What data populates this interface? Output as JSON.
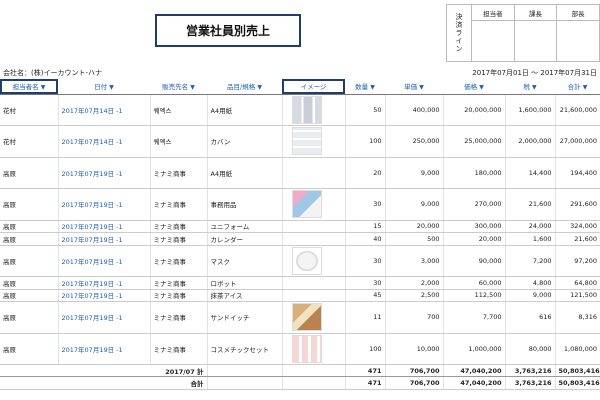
{
  "title": "営業社員別売上",
  "approval": {
    "label": "決済ライン",
    "columns": [
      "担当者",
      "課長",
      "部長"
    ]
  },
  "company": "会社名：(株)イーカウント-ハナ",
  "period": "2017年07月01日 ～ 2017年07月31日",
  "headers": {
    "person": "担当者名",
    "date": "日付",
    "customer": "販売先名",
    "item": "品目/規格",
    "image": "イメージ",
    "qty": "数量",
    "unit_price": "単価",
    "price": "価格",
    "tax": "税",
    "total": "合計",
    "caret": "▼"
  },
  "rows": [
    {
      "person": "花村",
      "date": "2017年07月14日 -1",
      "customer": "퀘엑스",
      "item": "A4用紙",
      "image": "shelf",
      "qty": "50",
      "unit_price": "400,000",
      "price": "20,000,000",
      "tax": "1,600,000",
      "total": "21,600,000"
    },
    {
      "person": "花村",
      "date": "2017年07月14日 -1",
      "customer": "퀘엑스",
      "item": "カバン",
      "image": "bag",
      "qty": "100",
      "unit_price": "250,000",
      "price": "25,000,000",
      "tax": "2,000,000",
      "total": "27,000,000"
    },
    {
      "person": "高原",
      "date": "2017年07月19日 -1",
      "customer": "ミナミ商事",
      "item": "A4用紙",
      "image": "",
      "qty": "20",
      "unit_price": "9,000",
      "price": "180,000",
      "tax": "14,400",
      "total": "194,400"
    },
    {
      "person": "高原",
      "date": "2017年07月19日 -1",
      "customer": "ミナミ商事",
      "item": "事務用品",
      "image": "office",
      "qty": "30",
      "unit_price": "9,000",
      "price": "270,000",
      "tax": "21,600",
      "total": "291,600"
    },
    {
      "person": "高原",
      "date": "2017年07月19日 -1",
      "customer": "ミナミ商事",
      "item": "ユニフォーム",
      "image": "",
      "qty": "15",
      "unit_price": "20,000",
      "price": "300,000",
      "tax": "24,000",
      "total": "324,000"
    },
    {
      "person": "高原",
      "date": "2017年07月19日 -1",
      "customer": "ミナミ商事",
      "item": "カレンダー",
      "image": "",
      "qty": "40",
      "unit_price": "500",
      "price": "20,000",
      "tax": "1,600",
      "total": "21,600"
    },
    {
      "person": "高原",
      "date": "2017年07月19日 -1",
      "customer": "ミナミ商事",
      "item": "マスク",
      "image": "mask",
      "qty": "30",
      "unit_price": "3,000",
      "price": "90,000",
      "tax": "7,200",
      "total": "97,200"
    },
    {
      "person": "高原",
      "date": "2017年07月19日 -1",
      "customer": "ミナミ商事",
      "item": "ロボット",
      "image": "",
      "qty": "30",
      "unit_price": "2,000",
      "price": "60,000",
      "tax": "4,800",
      "total": "64,800"
    },
    {
      "person": "高原",
      "date": "2017年07月19日 -1",
      "customer": "ミナミ商事",
      "item": "抹茶アイス",
      "image": "",
      "qty": "45",
      "unit_price": "2,500",
      "price": "112,500",
      "tax": "9,000",
      "total": "121,500"
    },
    {
      "person": "高原",
      "date": "2017年07月19日 -1",
      "customer": "ミナミ商事",
      "item": "サンドイッチ",
      "image": "sand",
      "qty": "11",
      "unit_price": "700",
      "price": "7,700",
      "tax": "616",
      "total": "8,316"
    },
    {
      "person": "高原",
      "date": "2017年07月19日 -1",
      "customer": "ミナミ商事",
      "item": "コスメチックセット",
      "image": "cos",
      "qty": "100",
      "unit_price": "10,000",
      "price": "1,000,000",
      "tax": "80,000",
      "total": "1,080,000"
    }
  ],
  "subtotal": {
    "label": "2017/07 計",
    "qty": "471",
    "unit_price": "706,700",
    "price": "47,040,200",
    "tax": "3,763,216",
    "total": "50,803,416"
  },
  "grandtotal": {
    "label": "合計",
    "qty": "471",
    "unit_price": "706,700",
    "price": "47,040,200",
    "tax": "3,763,216",
    "total": "50,803,416"
  }
}
